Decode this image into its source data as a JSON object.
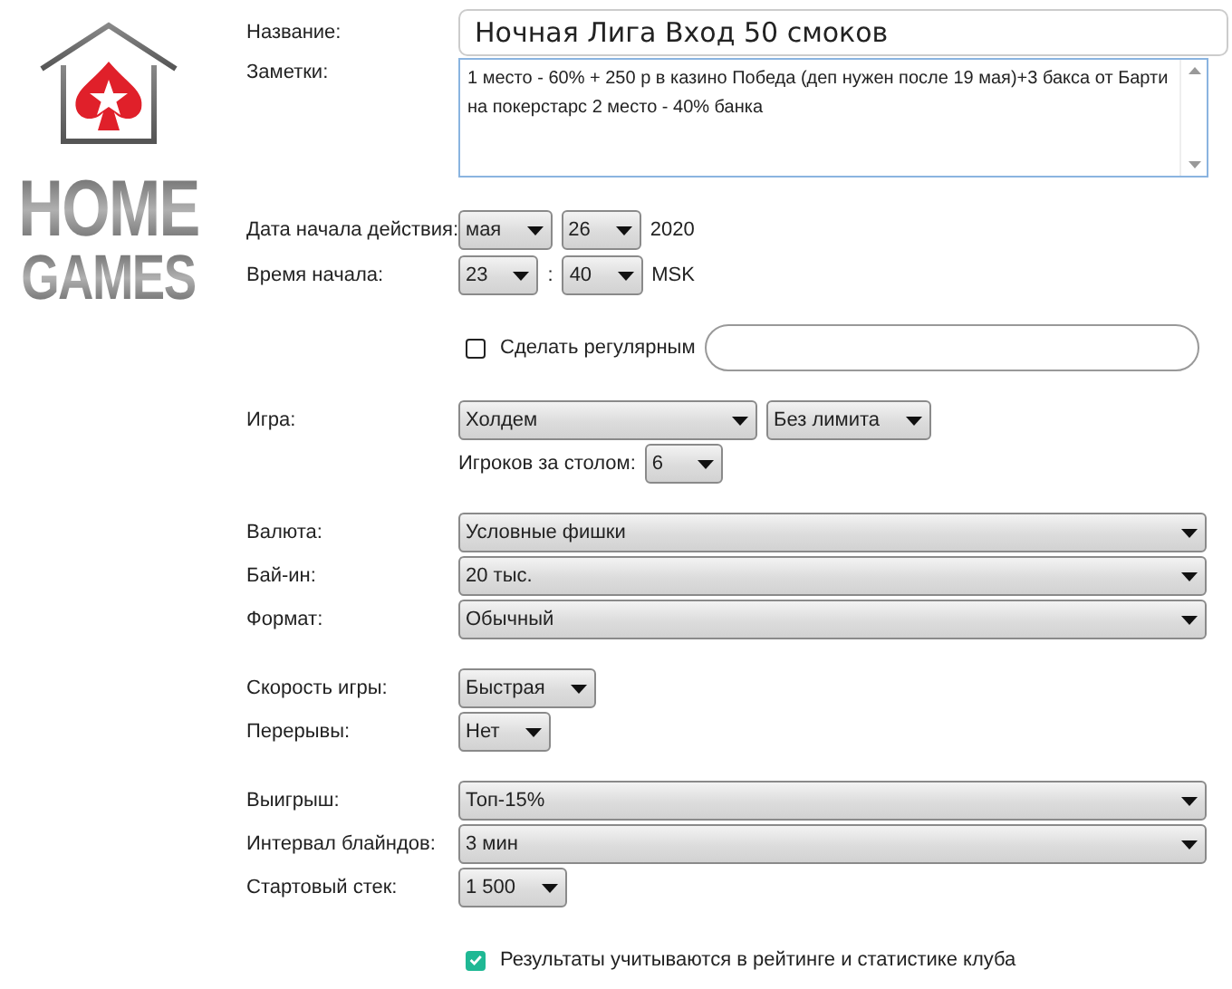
{
  "logo": {
    "line1": "HOME",
    "line2": "GAMES"
  },
  "sections": [
    {
      "rows": [
        {
          "label": "Название:",
          "controls": [
            {
              "kind": "input",
              "value": "Ночная Лига Вход 50 смоков"
            }
          ]
        },
        {
          "label": "Заметки:",
          "controls": [
            {
              "kind": "textarea",
              "value": "1 место - 60% + 250 р в казино Победа (деп нужен после 19 мая)+3 бакса от Барти на покерстарс 2 место - 40% банка"
            }
          ]
        },
        {
          "label": "Дата начала действия:",
          "controls": [
            {
              "kind": "select",
              "value": "мая"
            },
            {
              "kind": "select",
              "value": "26"
            },
            {
              "kind": "text",
              "value": "2020"
            }
          ]
        },
        {
          "label": "Время начала:",
          "controls": [
            {
              "kind": "select",
              "value": "23"
            },
            {
              "kind": "text",
              "value": ":"
            },
            {
              "kind": "select",
              "value": "40"
            },
            {
              "kind": "text",
              "value": "MSK"
            }
          ]
        }
      ]
    },
    {
      "rows": [
        {
          "controls": [
            {
              "kind": "checkbox",
              "label": "Сделать регулярным",
              "checked": false
            },
            {
              "kind": "round-input"
            }
          ]
        }
      ]
    },
    {
      "rows": [
        {
          "label": "Игра:",
          "controls": [
            {
              "kind": "long-select",
              "value": "Холдем"
            },
            {
              "kind": "select",
              "value": "Без лимита"
            }
          ]
        },
        {
          "controls": [
            {
              "kind": "text",
              "value": "Игроков за столом:"
            },
            {
              "kind": "select",
              "value": "6"
            }
          ]
        }
      ]
    },
    {
      "rows": [
        {
          "label": "Валюта:",
          "controls": [
            {
              "kind": "wide-select",
              "value": "Условные фишки"
            }
          ]
        },
        {
          "label": "Бай-ин:",
          "controls": [
            {
              "kind": "wide-select",
              "value": "20 тыс."
            }
          ]
        },
        {
          "label": "Формат:",
          "controls": [
            {
              "kind": "wide-select",
              "value": "Обычный"
            }
          ]
        }
      ]
    },
    {
      "rows": [
        {
          "label": "Скорость игры:",
          "controls": [
            {
              "kind": "select",
              "value": "Быстрая"
            }
          ]
        },
        {
          "label": "Перерывы:",
          "controls": [
            {
              "kind": "select",
              "value": "Нет"
            }
          ]
        }
      ]
    },
    {
      "rows": [
        {
          "label": "Выигрыш:",
          "controls": [
            {
              "kind": "wide-select",
              "value": "Топ-15%"
            }
          ]
        },
        {
          "label": "Интервал блайндов:",
          "controls": [
            {
              "kind": "wide-select",
              "value": "3 мин"
            }
          ]
        },
        {
          "label": "Стартовый стек:",
          "controls": [
            {
              "kind": "select",
              "value": "1 500"
            }
          ]
        }
      ]
    },
    {
      "rows": [
        {
          "controls": [
            {
              "kind": "checkbox",
              "label": "Результаты учитываются в рейтинге и статистике клуба",
              "checked": true
            }
          ]
        }
      ]
    }
  ]
}
